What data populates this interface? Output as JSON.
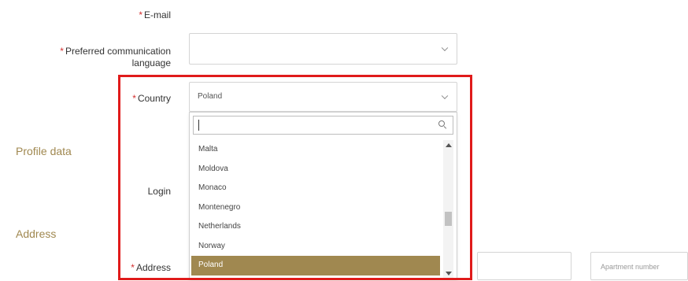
{
  "form": {
    "email_label": "E-mail",
    "language_label_line1": "Preferred communication",
    "language_label_line2": "language",
    "language_value": "",
    "country_label": "Country",
    "country_value": "Poland",
    "login_label": "Login",
    "address_label": "Address",
    "apartment_placeholder": "Apartment number",
    "required_mark": "*"
  },
  "sections": {
    "profile_data": "Profile data",
    "address": "Address"
  },
  "dropdown": {
    "search_value": "",
    "items": [
      "Malta",
      "Moldova",
      "Monaco",
      "Montenegro",
      "Netherlands",
      "Norway",
      "Poland"
    ],
    "selected_index": 6,
    "scroll_fraction": 0.6
  },
  "colors": {
    "accent": "#a08850",
    "highlight_border": "#e01b1b",
    "required": "#d32f2f"
  }
}
